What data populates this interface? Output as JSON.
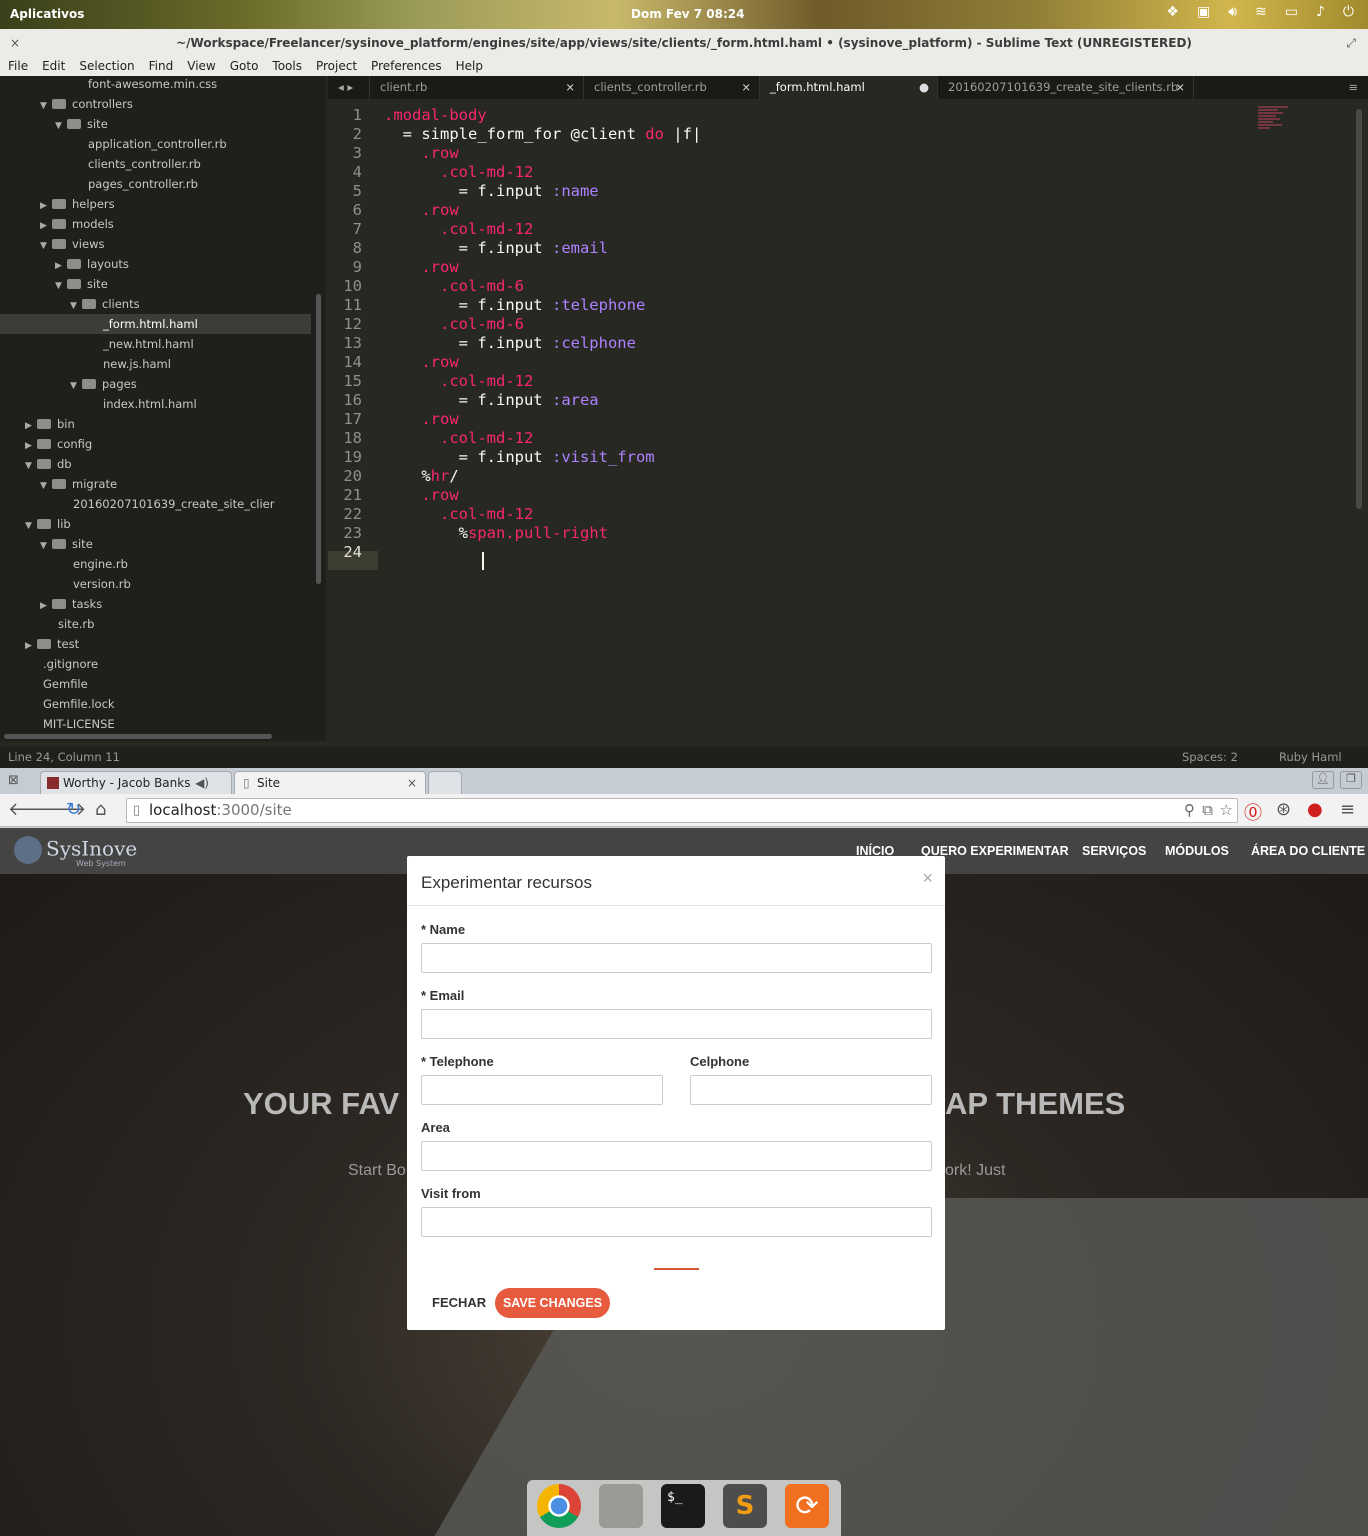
{
  "topbar": {
    "apps": "Aplicativos",
    "clock": "Dom Fev 7   08:24",
    "tray_icons": [
      "dropbox-icon",
      "pt-icon",
      "volume-icon",
      "wifi-icon",
      "battery-icon",
      "bell-icon",
      "power-icon"
    ]
  },
  "sublime": {
    "title": "~/Workspace/Freelancer/sysinove_platform/engines/site/app/views/site/clients/_form.html.haml • (sysinove_platform) - Sublime Text (UNREGISTERED)",
    "menu": [
      "File",
      "Edit",
      "Selection",
      "Find",
      "View",
      "Goto",
      "Tools",
      "Project",
      "Preferences",
      "Help"
    ],
    "tree": [
      {
        "label": "font-awesome.min.css",
        "type": "file",
        "depth": 4
      },
      {
        "label": "controllers",
        "type": "folder",
        "depth": 2,
        "open": true
      },
      {
        "label": "site",
        "type": "folder",
        "depth": 3,
        "open": true
      },
      {
        "label": "application_controller.rb",
        "type": "file",
        "depth": 4
      },
      {
        "label": "clients_controller.rb",
        "type": "file",
        "depth": 4
      },
      {
        "label": "pages_controller.rb",
        "type": "file",
        "depth": 4
      },
      {
        "label": "helpers",
        "type": "folder",
        "depth": 2,
        "open": false
      },
      {
        "label": "models",
        "type": "folder",
        "depth": 2,
        "open": false
      },
      {
        "label": "views",
        "type": "folder",
        "depth": 2,
        "open": true
      },
      {
        "label": "layouts",
        "type": "folder",
        "depth": 3,
        "open": false
      },
      {
        "label": "site",
        "type": "folder",
        "depth": 3,
        "open": true
      },
      {
        "label": "clients",
        "type": "folder",
        "depth": 4,
        "open": true
      },
      {
        "label": "_form.html.haml",
        "type": "file",
        "depth": 5,
        "selected": true
      },
      {
        "label": "_new.html.haml",
        "type": "file",
        "depth": 5
      },
      {
        "label": "new.js.haml",
        "type": "file",
        "depth": 5
      },
      {
        "label": "pages",
        "type": "folder",
        "depth": 4,
        "open": true
      },
      {
        "label": "index.html.haml",
        "type": "file",
        "depth": 5
      },
      {
        "label": "bin",
        "type": "folder",
        "depth": 1,
        "open": false
      },
      {
        "label": "config",
        "type": "folder",
        "depth": 1,
        "open": false
      },
      {
        "label": "db",
        "type": "folder",
        "depth": 1,
        "open": true
      },
      {
        "label": "migrate",
        "type": "folder",
        "depth": 2,
        "open": true
      },
      {
        "label": "20160207101639_create_site_clier",
        "type": "file",
        "depth": 3
      },
      {
        "label": "lib",
        "type": "folder",
        "depth": 1,
        "open": true
      },
      {
        "label": "site",
        "type": "folder",
        "depth": 2,
        "open": true
      },
      {
        "label": "engine.rb",
        "type": "file",
        "depth": 3
      },
      {
        "label": "version.rb",
        "type": "file",
        "depth": 3
      },
      {
        "label": "tasks",
        "type": "folder",
        "depth": 2,
        "open": false
      },
      {
        "label": "site.rb",
        "type": "file",
        "depth": 2
      },
      {
        "label": "test",
        "type": "folder",
        "depth": 1,
        "open": false
      },
      {
        "label": ".gitignore",
        "type": "file",
        "depth": 1
      },
      {
        "label": "Gemfile",
        "type": "file",
        "depth": 1
      },
      {
        "label": "Gemfile.lock",
        "type": "file",
        "depth": 1
      },
      {
        "label": "MIT-LICENSE",
        "type": "file",
        "depth": 1
      }
    ],
    "tabs": [
      {
        "label": "client.rb",
        "close": "×",
        "active": false
      },
      {
        "label": "clients_controller.rb",
        "close": "×",
        "active": false
      },
      {
        "label": "_form.html.haml",
        "close": "●",
        "active": true
      },
      {
        "label": "20160207101639_create_site_clients.rb",
        "close": "×",
        "active": false
      }
    ],
    "code": [
      [
        [
          ".modal-body",
          "k"
        ]
      ],
      [
        [
          "  = simple_form_for @client ",
          ""
        ],
        [
          "do",
          "k"
        ],
        [
          " |f|",
          ""
        ]
      ],
      [
        [
          "    ",
          ""
        ],
        [
          ".row",
          "k"
        ]
      ],
      [
        [
          "      ",
          ""
        ],
        [
          ".col-md-12",
          "k"
        ]
      ],
      [
        [
          "        = f.input ",
          ""
        ],
        [
          ":name",
          "s"
        ]
      ],
      [
        [
          "    ",
          ""
        ],
        [
          ".row",
          "k"
        ]
      ],
      [
        [
          "      ",
          ""
        ],
        [
          ".col-md-12",
          "k"
        ]
      ],
      [
        [
          "        = f.input ",
          ""
        ],
        [
          ":email",
          "s"
        ]
      ],
      [
        [
          "    ",
          ""
        ],
        [
          ".row",
          "k"
        ]
      ],
      [
        [
          "      ",
          ""
        ],
        [
          ".col-md-6",
          "k"
        ]
      ],
      [
        [
          "        = f.input ",
          ""
        ],
        [
          ":telephone",
          "s"
        ]
      ],
      [
        [
          "      ",
          ""
        ],
        [
          ".col-md-6",
          "k"
        ]
      ],
      [
        [
          "        = f.input ",
          ""
        ],
        [
          ":celphone",
          "s"
        ]
      ],
      [
        [
          "    ",
          ""
        ],
        [
          ".row",
          "k"
        ]
      ],
      [
        [
          "      ",
          ""
        ],
        [
          ".col-md-12",
          "k"
        ]
      ],
      [
        [
          "        = f.input ",
          ""
        ],
        [
          ":area",
          "s"
        ]
      ],
      [
        [
          "    ",
          ""
        ],
        [
          ".row",
          "k"
        ]
      ],
      [
        [
          "      ",
          ""
        ],
        [
          ".col-md-12",
          "k"
        ]
      ],
      [
        [
          "        = f.input ",
          ""
        ],
        [
          ":visit_from",
          "s"
        ]
      ],
      [
        [
          "    %",
          ""
        ],
        [
          "hr",
          "k"
        ],
        [
          "/",
          ""
        ]
      ],
      [
        [
          "    ",
          ""
        ],
        [
          ".row",
          "k"
        ]
      ],
      [
        [
          "      ",
          ""
        ],
        [
          ".col-md-12",
          "k"
        ]
      ],
      [
        [
          "        %",
          ""
        ],
        [
          "span.pull-right",
          "k"
        ]
      ],
      [
        [
          "",
          ""
        ]
      ]
    ],
    "status": {
      "position": "Line 24, Column 11",
      "spaces": "Spaces: 2",
      "syntax": "Ruby Haml"
    }
  },
  "browser": {
    "tabs": [
      {
        "label": "Worthy - Jacob Banks",
        "active": false
      },
      {
        "label": "Site",
        "active": true
      }
    ],
    "url_host": "localhost",
    "url_path": ":3000/site"
  },
  "site": {
    "brand": "SysInove",
    "brand_sub": "Web System",
    "nav": [
      "INÍCIO",
      "QUERO EXPERIMENTAR",
      "SERVIÇOS",
      "MÓDULOS",
      "ÁREA DO CLIENTE"
    ],
    "hero_left": "YOUR FAV",
    "hero_right": "AP THEMES",
    "sub_left": "Start Bo",
    "sub_right": "ork! Just"
  },
  "modal": {
    "title": "Experimentar recursos",
    "close": "×",
    "fields": {
      "name": "* Name",
      "email": "* Email",
      "telephone": "* Telephone",
      "celphone": "Celphone",
      "area": "Area",
      "visit_from": "Visit from"
    },
    "btn_close": "FECHAR",
    "btn_save": "SAVE CHANGES"
  },
  "dock": [
    "chrome-icon",
    "files-icon",
    "terminal-icon",
    "sublime-icon",
    "update-icon"
  ]
}
